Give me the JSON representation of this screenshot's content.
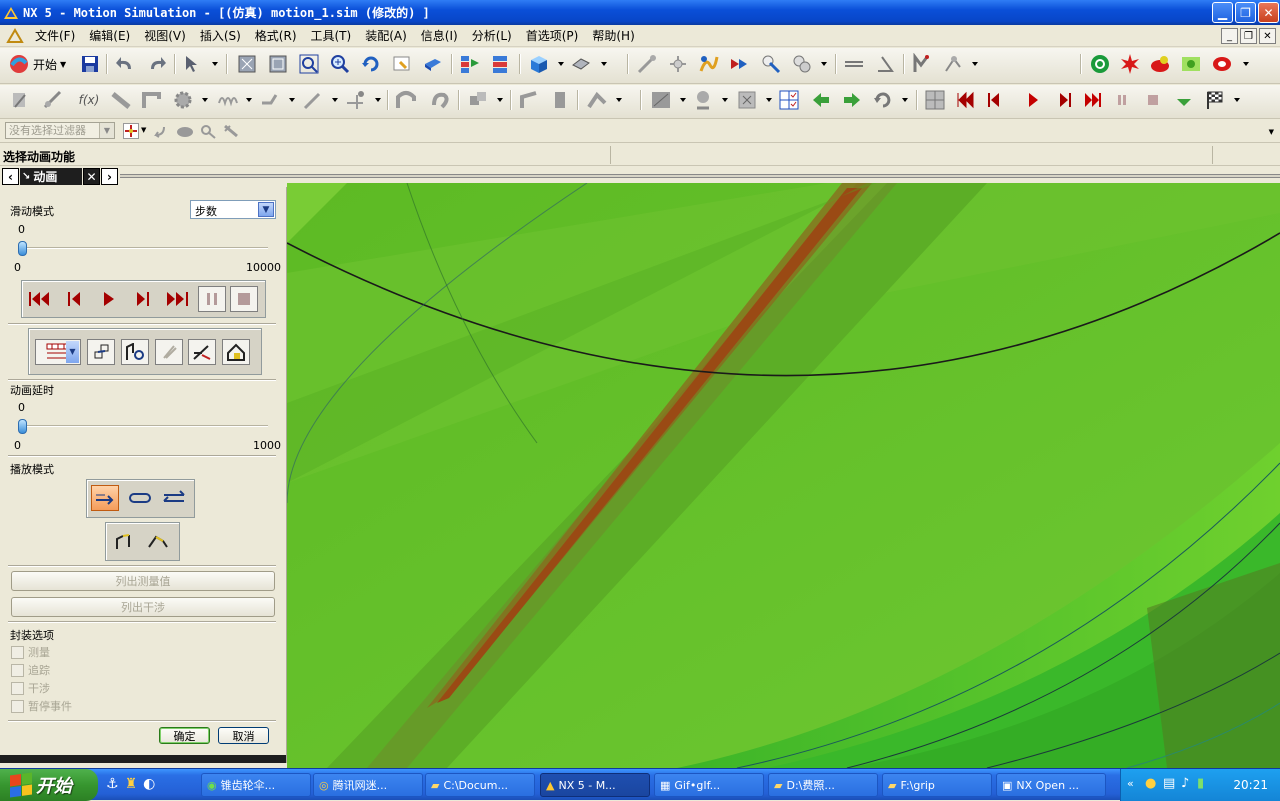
{
  "window": {
    "title": "NX 5 - Motion Simulation - [(仿真) motion_1.sim (修改的) ]"
  },
  "menu": {
    "items": [
      "文件(F)",
      "编辑(E)",
      "视图(V)",
      "插入(S)",
      "格式(R)",
      "工具(T)",
      "装配(A)",
      "信息(I)",
      "分析(L)",
      "首选项(P)",
      "帮助(H)"
    ]
  },
  "toolbar": {
    "start_label": "开始"
  },
  "filter": {
    "value": "没有选择过滤器"
  },
  "cue": {
    "text": "选择动画功能"
  },
  "panel_tab": {
    "label": "动画"
  },
  "animation": {
    "slider_mode_label": "滑动模式",
    "slider_mode_value": "步数",
    "step_value": "0",
    "step_min": "0",
    "step_max": "10000",
    "step_fraction": 0,
    "delay_label": "动画延时",
    "delay_value": "0",
    "delay_min": "0",
    "delay_max": "1000",
    "delay_fraction": 0,
    "playback_label": "播放模式",
    "list_measure_label": "列出测量值",
    "list_interference_label": "列出干涉",
    "package_label": "封装选项",
    "checkboxes": [
      "测量",
      "追踪",
      "干涉",
      "暂停事件"
    ],
    "ok_label": "确定",
    "cancel_label": "取消"
  },
  "colors": {
    "xp_blue": "#0a4fd8",
    "playback_red": "#a40000",
    "viewport_green": "#6cc22b"
  },
  "taskbar": {
    "start_label": "开始",
    "tasks": [
      "锥齿轮伞...",
      "腾讯网迷...",
      "C:\\Docum...",
      "NX 5 - M...",
      "Gif•gIf...",
      "D:\\费照...",
      "F:\\grip",
      "NX Open ..."
    ],
    "clock": "20:21"
  }
}
